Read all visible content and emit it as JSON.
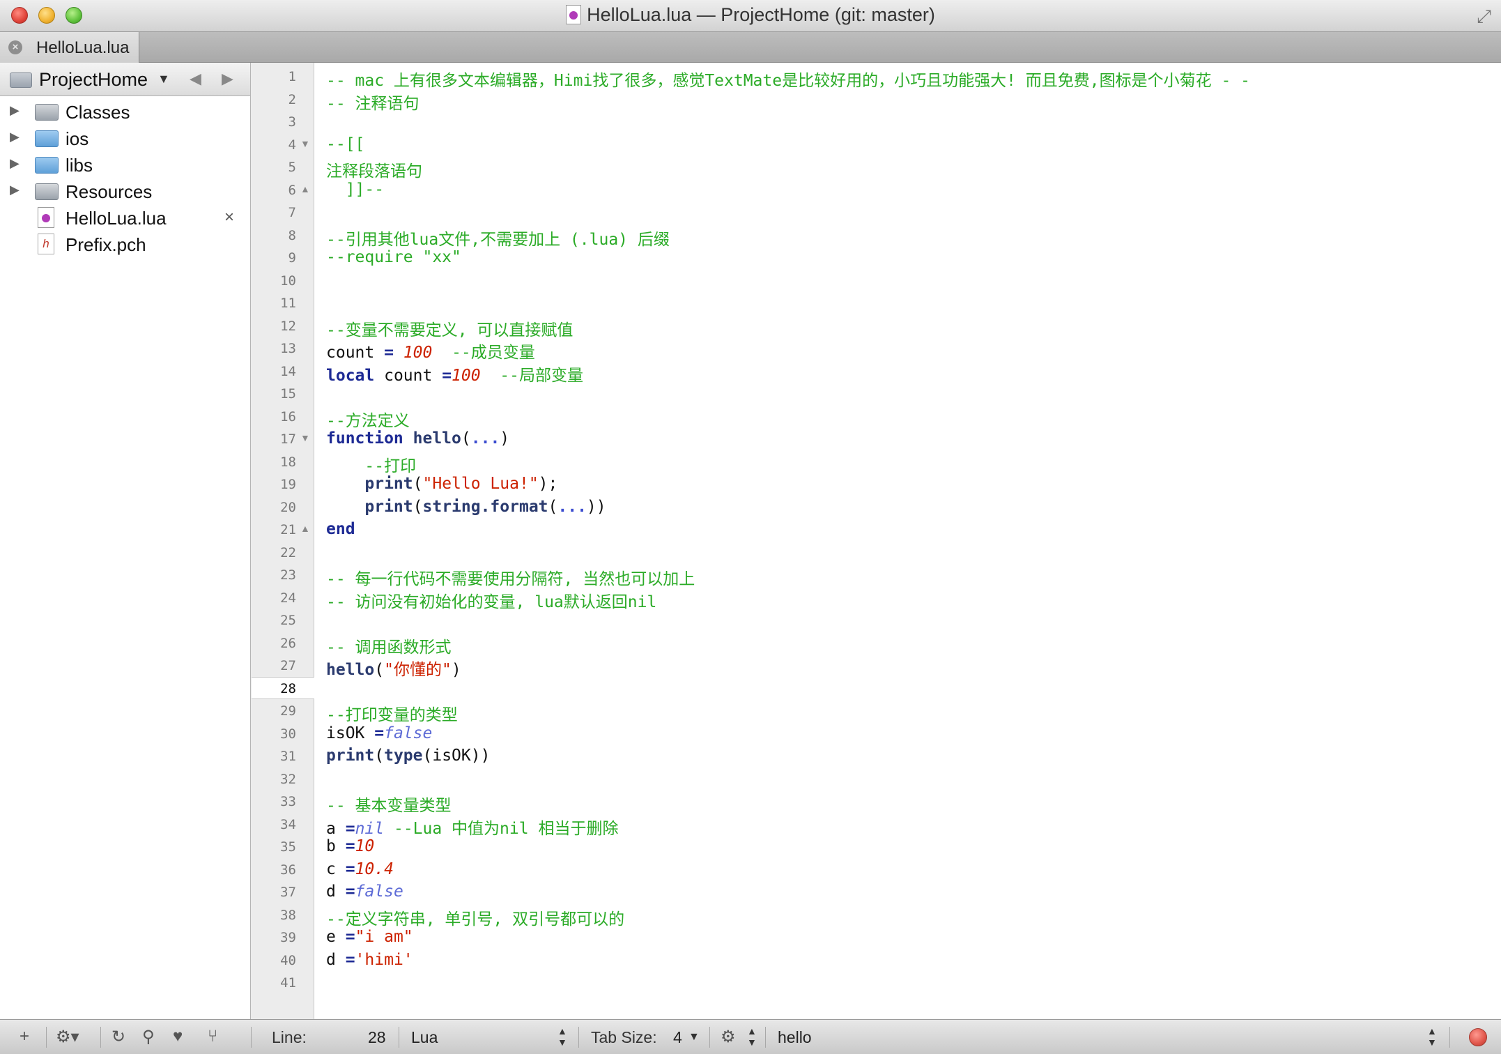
{
  "window": {
    "title": "HelloLua.lua — ProjectHome (git: master)"
  },
  "tabs": [
    {
      "label": "HelloLua.lua"
    }
  ],
  "sidebar": {
    "project": "ProjectHome",
    "items": [
      {
        "label": "Classes",
        "type": "group"
      },
      {
        "label": "ios",
        "type": "folder"
      },
      {
        "label": "libs",
        "type": "folder"
      },
      {
        "label": "Resources",
        "type": "group"
      },
      {
        "label": "HelloLua.lua",
        "type": "lua"
      },
      {
        "label": "Prefix.pch",
        "type": "header"
      }
    ],
    "close_glyph": "×"
  },
  "editor": {
    "current_line": 28,
    "lines": [
      {
        "n": "1",
        "fold": "",
        "segs": [
          [
            "c-cm",
            "-- mac 上有很多文本编辑器，Himi找了很多，感觉TextMate是比较好用的，小巧且功能强大! 而且免费,图标是个小菊花 - -"
          ]
        ]
      },
      {
        "n": "2",
        "fold": "",
        "segs": [
          [
            "c-cm",
            "-- 注释语句"
          ]
        ]
      },
      {
        "n": "3",
        "fold": "",
        "segs": []
      },
      {
        "n": "4",
        "fold": "▼",
        "segs": [
          [
            "c-cm",
            "--[["
          ]
        ]
      },
      {
        "n": "5",
        "fold": "",
        "segs": [
          [
            "c-cm",
            "注释段落语句"
          ]
        ]
      },
      {
        "n": "6",
        "fold": "▲",
        "segs": [
          [
            "c-cm",
            "  ]]--"
          ]
        ]
      },
      {
        "n": "7",
        "fold": "",
        "segs": []
      },
      {
        "n": "8",
        "fold": "",
        "segs": [
          [
            "c-cm",
            "--引用其他lua文件,不需要加上 (.lua) 后缀"
          ]
        ]
      },
      {
        "n": "9",
        "fold": "",
        "segs": [
          [
            "c-cm",
            "--require \"xx\""
          ]
        ]
      },
      {
        "n": "10",
        "fold": "",
        "segs": []
      },
      {
        "n": "11",
        "fold": "",
        "segs": []
      },
      {
        "n": "12",
        "fold": "",
        "segs": [
          [
            "c-cm",
            "--变量不需要定义, 可以直接赋值"
          ]
        ]
      },
      {
        "n": "13",
        "fold": "",
        "segs": [
          [
            "",
            "count "
          ],
          [
            "c-op",
            "="
          ],
          [
            "",
            " "
          ],
          [
            "c-num",
            "100"
          ],
          [
            "",
            " "
          ],
          [
            "c-cm",
            " --成员变量"
          ]
        ]
      },
      {
        "n": "14",
        "fold": "",
        "segs": [
          [
            "c-kw",
            "local"
          ],
          [
            "",
            " count "
          ],
          [
            "c-op",
            "="
          ],
          [
            "c-num",
            "100"
          ],
          [
            "",
            "  "
          ],
          [
            "c-cm",
            "--局部变量"
          ]
        ]
      },
      {
        "n": "15",
        "fold": "",
        "segs": []
      },
      {
        "n": "16",
        "fold": "",
        "segs": [
          [
            "c-cm",
            "--方法定义"
          ]
        ]
      },
      {
        "n": "17",
        "fold": "▼",
        "segs": [
          [
            "c-kw",
            "function"
          ],
          [
            "",
            " "
          ],
          [
            "c-fn",
            "hello"
          ],
          [
            "",
            "("
          ],
          [
            "c-dots",
            "..."
          ],
          [
            "",
            ")"
          ]
        ]
      },
      {
        "n": "18",
        "fold": "",
        "segs": [
          [
            "",
            "    "
          ],
          [
            "c-cm",
            "--打印"
          ]
        ]
      },
      {
        "n": "19",
        "fold": "",
        "segs": [
          [
            "",
            "    "
          ],
          [
            "c-fn",
            "print"
          ],
          [
            "",
            "("
          ],
          [
            "c-str",
            "\"Hello Lua!\""
          ],
          [
            "",
            ");"
          ]
        ]
      },
      {
        "n": "20",
        "fold": "",
        "segs": [
          [
            "",
            "    "
          ],
          [
            "c-fn",
            "print"
          ],
          [
            "",
            "("
          ],
          [
            "c-fn",
            "string.format"
          ],
          [
            "",
            "("
          ],
          [
            "c-dots",
            "..."
          ],
          [
            "",
            "))"
          ]
        ]
      },
      {
        "n": "21",
        "fold": "▲",
        "segs": [
          [
            "c-kw",
            "end"
          ]
        ]
      },
      {
        "n": "22",
        "fold": "",
        "segs": []
      },
      {
        "n": "23",
        "fold": "",
        "segs": [
          [
            "c-cm",
            "-- 每一行代码不需要使用分隔符, 当然也可以加上"
          ]
        ]
      },
      {
        "n": "24",
        "fold": "",
        "segs": [
          [
            "c-cm",
            "-- 访问没有初始化的变量, lua默认返回nil"
          ]
        ]
      },
      {
        "n": "25",
        "fold": "",
        "segs": []
      },
      {
        "n": "26",
        "fold": "",
        "segs": [
          [
            "c-cm",
            "-- 调用函数形式"
          ]
        ]
      },
      {
        "n": "27",
        "fold": "",
        "segs": [
          [
            "c-fn",
            "hello"
          ],
          [
            "",
            "("
          ],
          [
            "c-str",
            "\"你懂的\""
          ],
          [
            "",
            ")"
          ]
        ]
      },
      {
        "n": "28",
        "fold": "",
        "segs": []
      },
      {
        "n": "29",
        "fold": "",
        "segs": [
          [
            "c-cm",
            "--打印变量的类型"
          ]
        ]
      },
      {
        "n": "30",
        "fold": "",
        "segs": [
          [
            "",
            "isOK "
          ],
          [
            "c-op",
            "="
          ],
          [
            "c-bool",
            "false"
          ]
        ]
      },
      {
        "n": "31",
        "fold": "",
        "segs": [
          [
            "c-fn",
            "print"
          ],
          [
            "",
            "("
          ],
          [
            "c-fn",
            "type"
          ],
          [
            "",
            "(isOK))"
          ]
        ]
      },
      {
        "n": "32",
        "fold": "",
        "segs": []
      },
      {
        "n": "33",
        "fold": "",
        "segs": [
          [
            "c-cm",
            "-- 基本变量类型"
          ]
        ]
      },
      {
        "n": "34",
        "fold": "",
        "segs": [
          [
            "",
            "a "
          ],
          [
            "c-op",
            "="
          ],
          [
            "c-bool",
            "nil"
          ],
          [
            "",
            " "
          ],
          [
            "c-cm",
            "--Lua 中值为nil 相当于删除"
          ]
        ]
      },
      {
        "n": "35",
        "fold": "",
        "segs": [
          [
            "",
            "b "
          ],
          [
            "c-op",
            "="
          ],
          [
            "c-num",
            "10"
          ]
        ]
      },
      {
        "n": "36",
        "fold": "",
        "segs": [
          [
            "",
            "c "
          ],
          [
            "c-op",
            "="
          ],
          [
            "c-num",
            "10.4"
          ]
        ]
      },
      {
        "n": "37",
        "fold": "",
        "segs": [
          [
            "",
            "d "
          ],
          [
            "c-op",
            "="
          ],
          [
            "c-bool",
            "false"
          ]
        ]
      },
      {
        "n": "38",
        "fold": "",
        "segs": [
          [
            "c-cm",
            "--定义字符串, 单引号, 双引号都可以的"
          ]
        ]
      },
      {
        "n": "39",
        "fold": "",
        "segs": [
          [
            "",
            "e "
          ],
          [
            "c-op",
            "="
          ],
          [
            "c-str",
            "\"i am\""
          ]
        ]
      },
      {
        "n": "40",
        "fold": "",
        "segs": [
          [
            "",
            "d "
          ],
          [
            "c-op",
            "="
          ],
          [
            "c-str",
            "'himi'"
          ]
        ]
      },
      {
        "n": "41",
        "fold": "",
        "segs": []
      }
    ]
  },
  "statusbar": {
    "line_label": "Line:",
    "line_value": "28",
    "language": "Lua",
    "tabsize_label": "Tab Size:",
    "tabsize_value": "4",
    "symbol": "hello",
    "icons": [
      "plus-icon",
      "gear-icon",
      "refresh-icon",
      "search-icon",
      "heart-icon",
      "branch-icon"
    ]
  }
}
